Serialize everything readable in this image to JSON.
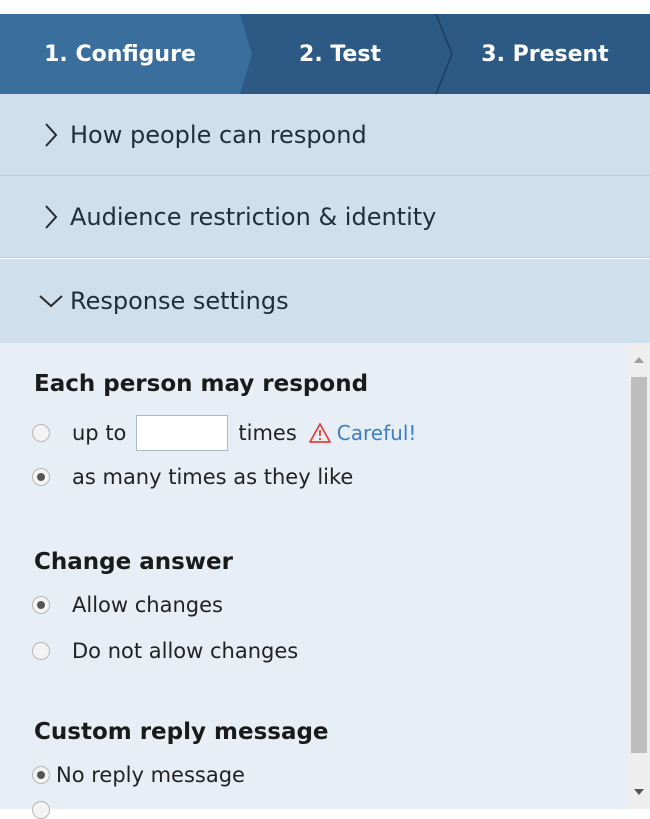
{
  "steps": [
    {
      "label": "1. Configure",
      "active": true
    },
    {
      "label": "2. Test",
      "active": false
    },
    {
      "label": "3. Present",
      "active": false
    }
  ],
  "accordion": [
    {
      "label": "How people can respond",
      "expanded": false
    },
    {
      "label": "Audience restriction & identity",
      "expanded": false
    },
    {
      "label": "Response settings",
      "expanded": true
    }
  ],
  "response_settings": {
    "each_person": {
      "heading": "Each person may respond",
      "up_to_label": "up to",
      "times_label": "times",
      "up_to_value": "",
      "warning_text": "Careful!",
      "as_many_label": "as many times as they like",
      "selected": "as_many"
    },
    "change_answer": {
      "heading": "Change answer",
      "allow_label": "Allow changes",
      "disallow_label": "Do not allow changes",
      "selected": "allow"
    },
    "custom_reply": {
      "heading": "Custom reply message",
      "no_reply_label": "No reply message",
      "selected": "none"
    }
  },
  "colors": {
    "tabs_bg": "#2d5a84",
    "active_tab_bg": "#3a6f9d",
    "accordion_bg": "#cfdfeb",
    "panel_bg": "#e7eef6",
    "warning": "#e0413c",
    "link": "#3b7fc4"
  }
}
